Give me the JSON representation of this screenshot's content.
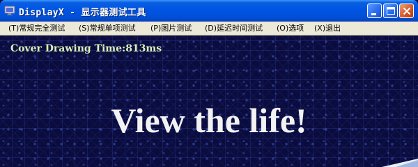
{
  "window": {
    "title": "DisplayX - 显示器测试工具"
  },
  "title_buttons": [
    "minimize",
    "maximize",
    "close"
  ],
  "menu": [
    {
      "accel": "T",
      "label": "常规完全测试"
    },
    {
      "accel": "S",
      "label": "常规单项测试"
    },
    {
      "accel": "P",
      "label": "图片测试"
    },
    {
      "accel": "D",
      "label": "延迟时间测试"
    },
    {
      "accel": "O",
      "label": "选项"
    },
    {
      "accel": "X",
      "label": "退出"
    }
  ],
  "content": {
    "draw_time": "Cover Drawing Time:813ms",
    "tagline": "View the life!"
  },
  "colors": {
    "titlebar": "#0054e3",
    "menubar": "#ece9d8",
    "background": "#0a0b3c",
    "draw_time_text": "#d9f0b6",
    "tagline_text": "#f2f2f2"
  }
}
